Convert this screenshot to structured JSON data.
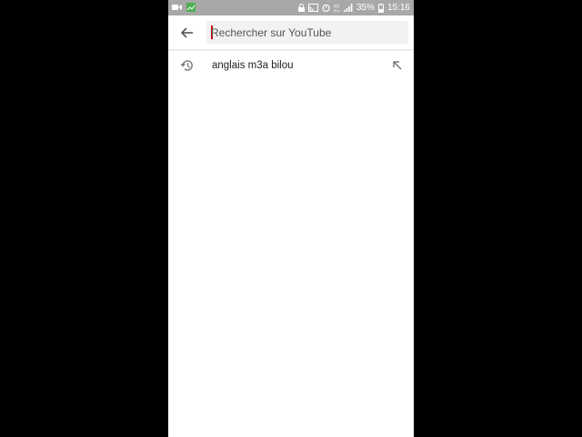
{
  "status_bar": {
    "battery_percent": "35%",
    "time": "15:16",
    "background_color": "#a8a8a8"
  },
  "search": {
    "placeholder": "Rechercher sur YouTube",
    "value": "",
    "caret_color": "#cc0000",
    "back_icon": "arrow-back-icon"
  },
  "suggestions": [
    {
      "text": "anglais m3a bilou",
      "leading_icon": "history-icon",
      "trailing_icon": "fill-query-arrow-icon"
    }
  ]
}
